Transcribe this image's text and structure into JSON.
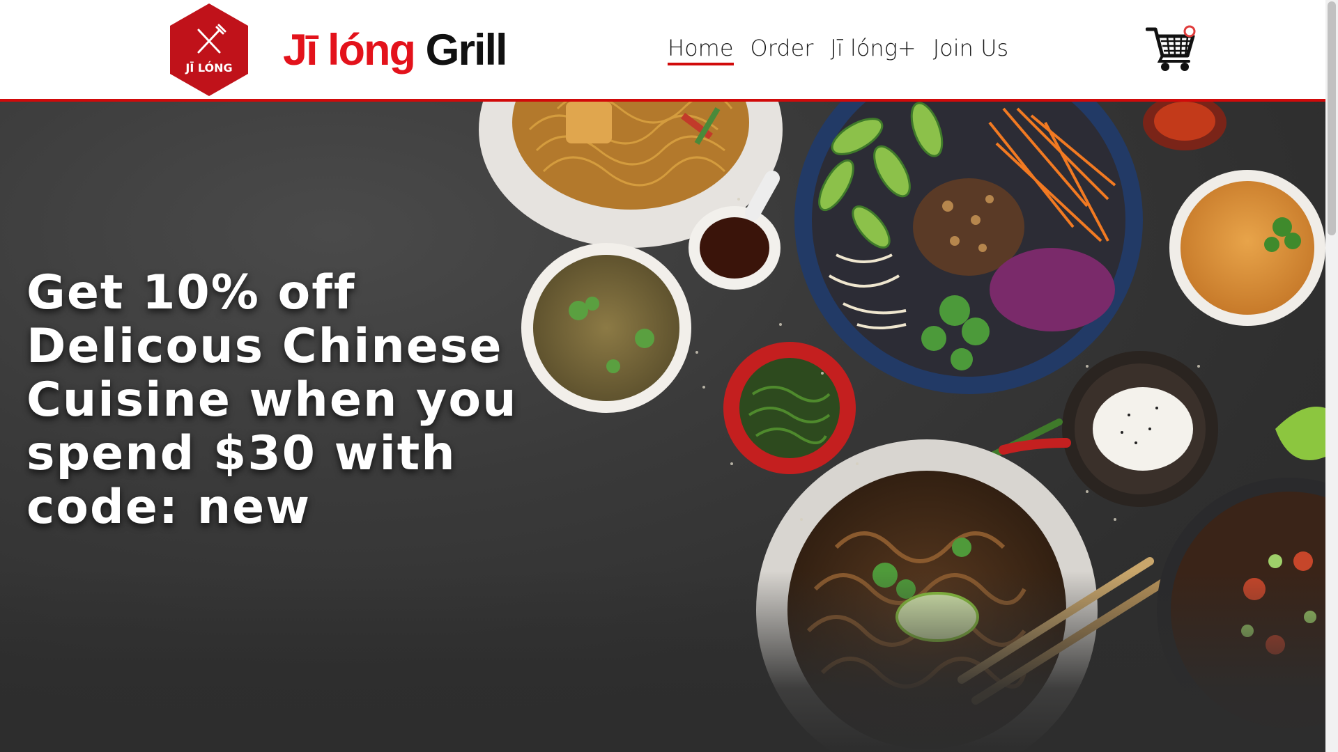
{
  "header": {
    "logo_badge_text": "JĪ LÓNG",
    "brand_red": "Jī lóng",
    "brand_dark": "Grill",
    "nav": [
      {
        "label": "Home",
        "active": true
      },
      {
        "label": "Order",
        "active": false
      },
      {
        "label": "Jī lóng+",
        "active": false
      },
      {
        "label": "Join Us",
        "active": false
      }
    ],
    "cart_icon": "shopping-cart-icon"
  },
  "hero": {
    "headline": "Get 10% off Delicous Chinese Cuisine when you spend $30 with code: new",
    "image": "chinese-food-spread-on-slate"
  },
  "colors": {
    "accent_red": "#d10a0a",
    "brand_red": "#e3121b",
    "hero_bg": "#2d2d2d"
  }
}
